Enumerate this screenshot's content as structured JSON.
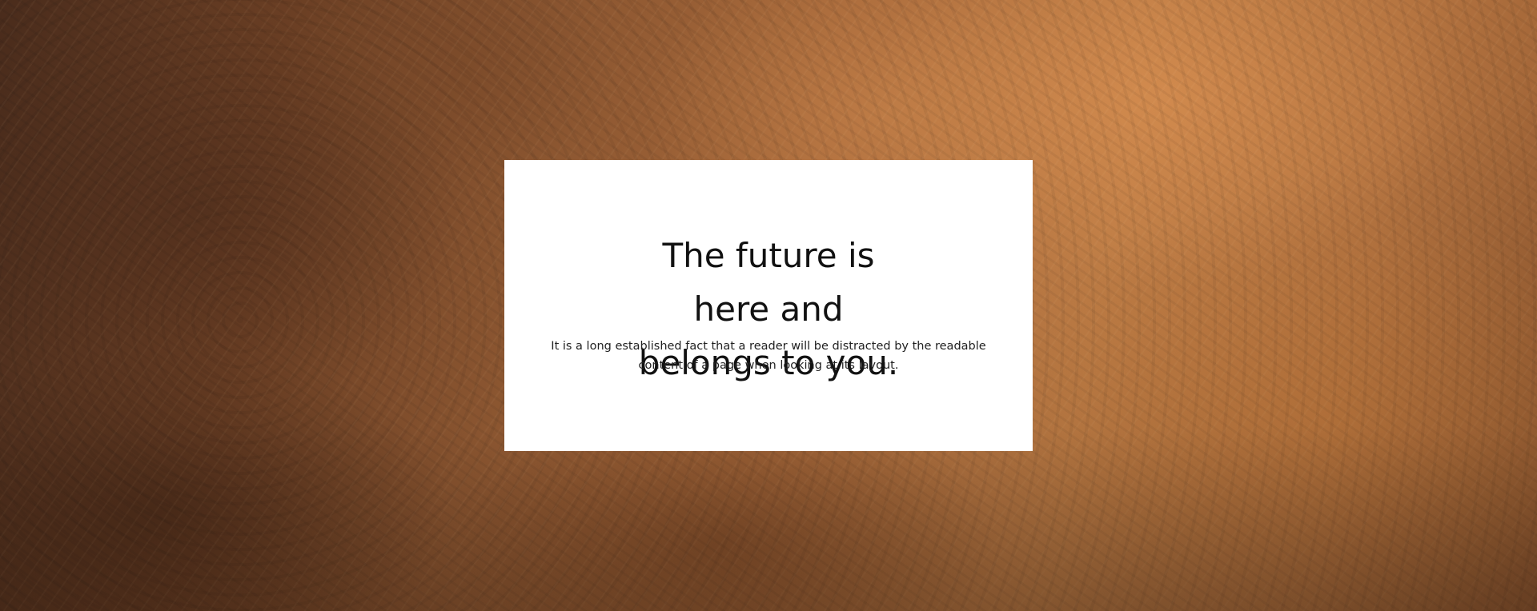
{
  "hero": {
    "background_image": "sandstone-canyon-rock",
    "colors": {
      "card_background": "#ffffff",
      "title_color": "#111111",
      "text_color": "#222222"
    }
  },
  "card": {
    "title": "The future is here and belongs to you.",
    "description": "It is a long established fact that a reader will be distracted by the readable content of a page when looking at its layout."
  }
}
